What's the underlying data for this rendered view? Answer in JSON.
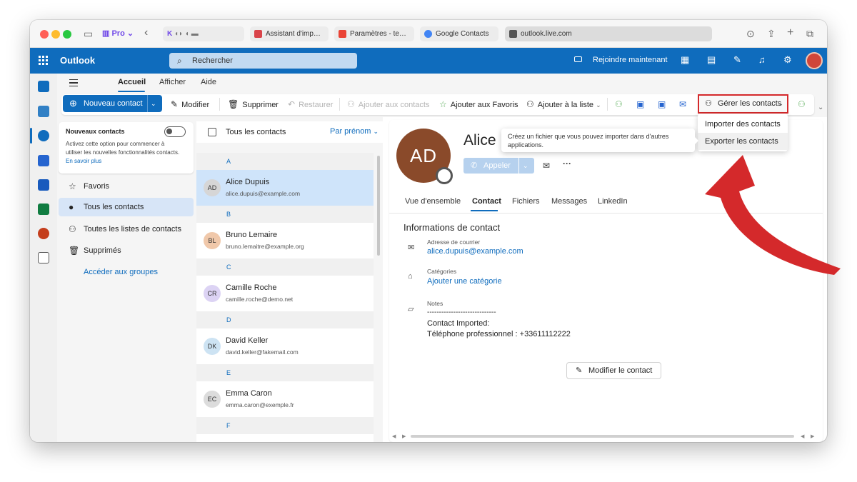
{
  "browser": {
    "profile": "Pro",
    "tabs": [
      {
        "label": "Assistant d'imp…",
        "color": "#d9444a"
      },
      {
        "label": "Paramètres - te…",
        "color": "#ea4335"
      },
      {
        "label": "Google Contacts",
        "color": "#4285f4"
      },
      {
        "label": "outlook.live.com",
        "color": "#555555"
      }
    ]
  },
  "suite": {
    "app_name": "Outlook",
    "search_placeholder": "Rechercher",
    "join_label": "Rejoindre maintenant"
  },
  "ribbon": {
    "tabs": [
      "Accueil",
      "Afficher",
      "Aide"
    ],
    "new_contact": "Nouveau contact",
    "edit": "Modifier",
    "delete": "Supprimer",
    "restore": "Restaurer",
    "add_to_contacts": "Ajouter aux contacts",
    "add_to_favorites": "Ajouter aux Favoris",
    "add_to_list": "Ajouter à la liste",
    "manage_contacts": "Gérer les contacts",
    "menu_items": [
      "Importer des contacts",
      "Exporter les contacts"
    ],
    "tooltip": "Créez un fichier que vous pouvez importer dans d'autres applications."
  },
  "nav": {
    "card_title": "Nouveaux contacts",
    "card_desc": "Activez cette option pour commencer à utiliser les nouvelles fonctionnalités contacts.",
    "card_link": "En savoir plus",
    "items": [
      {
        "label": "Favoris",
        "icon": "star-icon"
      },
      {
        "label": "Tous les contacts",
        "icon": "person-icon"
      },
      {
        "label": "Toutes les listes de contacts",
        "icon": "people-icon"
      },
      {
        "label": "Supprimés",
        "icon": "trash-icon"
      }
    ],
    "groups_link": "Accéder aux groupes"
  },
  "list": {
    "title": "Tous les contacts",
    "sort": "Par prénom",
    "letters": [
      "A",
      "B",
      "C",
      "D",
      "E",
      "F"
    ],
    "contacts": [
      {
        "initials": "AD",
        "name": "Alice Dupuis",
        "email": "alice.dupuis@example.com",
        "avatar_color": "#d6d6d6"
      },
      {
        "initials": "BL",
        "name": "Bruno Lemaire",
        "email": "bruno.lemaitre@example.org",
        "avatar_color": "#f0c8aa"
      },
      {
        "initials": "CR",
        "name": "Camille Roche",
        "email": "camille.roche@demo.net",
        "avatar_color": "#dcd3f4"
      },
      {
        "initials": "DK",
        "name": "David Keller",
        "email": "david.keller@fakemail.com",
        "avatar_color": "#cde3f3"
      },
      {
        "initials": "EC",
        "name": "Emma Caron",
        "email": "emma.caron@exemple.fr",
        "avatar_color": "#dcdcdc"
      }
    ]
  },
  "detail": {
    "initials": "AD",
    "name": "Alice",
    "call": "Appeler",
    "tabs": [
      "Vue d'ensemble",
      "Contact",
      "Fichiers",
      "Messages",
      "LinkedIn"
    ],
    "section_title": "Informations de contact",
    "email_label": "Adresse de courrier",
    "email_value": "alice.dupuis@example.com",
    "category_label": "Catégories",
    "category_link": "Ajouter une catégorie",
    "notes_label": "Notes",
    "notes_line1": "-----------------------------",
    "notes_line2": "Contact Imported:",
    "notes_line3": "Téléphone professionnel : +33611112222",
    "edit_button": "Modifier le contact"
  },
  "colors": {
    "brand": "#0f6cbd",
    "highlight": "#d4292b"
  }
}
